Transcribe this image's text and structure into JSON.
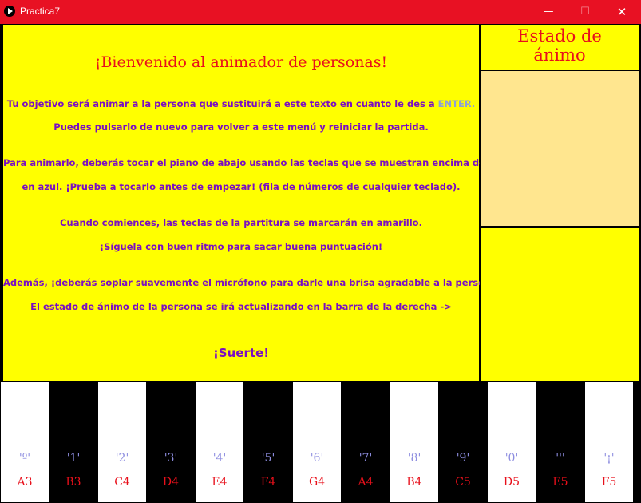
{
  "window": {
    "title": "Practica7",
    "minimize": "—",
    "maximize": "☐",
    "close": "✕"
  },
  "welcome": {
    "heading": "¡Bienvenido al animador de personas!",
    "line1_pre": "Tu objetivo será animar a la persona que sustituirá a este texto en cuanto le des a ",
    "line1_key": "ENTER.",
    "line2": "Puedes pulsarlo de nuevo para volver a este menú y reiniciar la partida.",
    "line3": "Para animarlo, deberás tocar el piano de abajo usando las teclas que se muestran encima de estas",
    "line4": "en azul. ¡Prueba a tocarlo antes de empezar! (fila de números de cualquier teclado).",
    "line5": "Cuando comiences, las teclas de la partitura se marcarán en amarillo.",
    "line6": "¡Síguela con buen ritmo para sacar buena puntuación!",
    "line7": "Además, ¡deberás soplar suavemente el micrófono para darle una brisa agradable a la persona!",
    "line8": "El estado de ánimo de la persona se irá actualizando en la barra de la derecha ->",
    "luck": "¡Suerte!"
  },
  "mood": {
    "title_line1": "Estado de",
    "title_line2": "ánimo"
  },
  "piano": {
    "keys": [
      {
        "color": "white",
        "key": "'º'",
        "note": "A3"
      },
      {
        "color": "black",
        "key": "'1'",
        "note": "B3"
      },
      {
        "color": "white",
        "key": "'2'",
        "note": "C4"
      },
      {
        "color": "black",
        "key": "'3'",
        "note": "D4"
      },
      {
        "color": "white",
        "key": "'4'",
        "note": "E4"
      },
      {
        "color": "black",
        "key": "'5'",
        "note": "F4"
      },
      {
        "color": "white",
        "key": "'6'",
        "note": "G4"
      },
      {
        "color": "black",
        "key": "'7'",
        "note": "A4"
      },
      {
        "color": "white",
        "key": "'8'",
        "note": "B4"
      },
      {
        "color": "black",
        "key": "'9'",
        "note": "C5"
      },
      {
        "color": "white",
        "key": "'0'",
        "note": "D5"
      },
      {
        "color": "black",
        "key": "'''",
        "note": "E5"
      },
      {
        "color": "white",
        "key": "'¡'",
        "note": "F5"
      }
    ]
  },
  "colors": {
    "titlebar": "#e81123",
    "panel": "#ffff00",
    "mood_bar": "#ffe68f",
    "heading": "#e8101b",
    "body_text": "#7a0fc2",
    "key_label": "#8e8ee0"
  }
}
